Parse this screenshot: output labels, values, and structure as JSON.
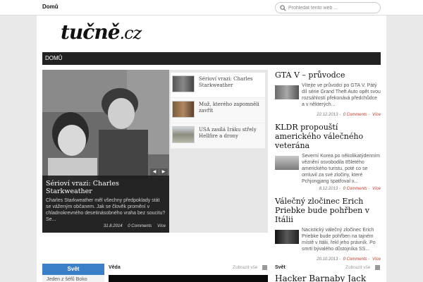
{
  "topbar": {
    "nav_home": "Domů",
    "search_placeholder": "Prohledat tento web ..."
  },
  "logo": {
    "main": "tučně",
    "suffix": ".cz"
  },
  "navbar": {
    "items": [
      "DOMŮ"
    ]
  },
  "featured": {
    "title": "Sérioví vrazi: Charles Starkweather",
    "excerpt": "Charles Starkweather měl všechny předpoklady stát se váženým občanem. Jak se člověk promění v chladnokrevného desetinásobného vraha bez soucitu? Se...",
    "date": "31.8.2014",
    "comments": "0 Comments",
    "more": "Více",
    "thumbs": [
      "Sérioví vrazi: Charles Starkweather",
      "Muž, kterého zapomněli zavřít",
      "USA zasílá Iráku střely Hellfire a drony"
    ]
  },
  "articles": [
    {
      "title": "GTA V – průvodce",
      "text": "Vítejte ve průvodci po GTA V. Pátý díl série Grand Theft Auto opět svou rozsáhlostí překonává předchůdce a v některých...",
      "date": "22.12.2013",
      "comments": "0 Comments",
      "more": "Více"
    },
    {
      "title": "KLDR propouští amerického válečného veterána",
      "text": "Severní Korea po několikatýdenním věznění osvobodila 85letého amerického turistu, poté co se omluvil za své zločiny, které Pchjongjang spatřoval v...",
      "date": "8.12.2013",
      "comments": "0 Comments",
      "more": "Více"
    },
    {
      "title": "Válečný zločinec Erich Priebke bude pohřben v Itálii",
      "text": "Nacistický válečný zločinec Erich Priebke bude pohřben na tajném místě v Itálii, řekl jeho právník. Po smrti bývalého důstojníka SS...",
      "date": "20.10.2013",
      "comments": "0 Comments",
      "more": "Více"
    }
  ],
  "sections": {
    "svet_tab": "Svět",
    "svet_item": "Jeden z šéfů Boko",
    "veda": "Věda",
    "veda_more": "Zobrazit vše",
    "svet": "Svět",
    "svet_more": "Zobrazit vše",
    "hacker_title": "Hacker Barnaby Jack"
  },
  "colors": {
    "accent_red": "#c0392b",
    "tab_blue": "#3a7fc8",
    "navbar": "#222222"
  }
}
